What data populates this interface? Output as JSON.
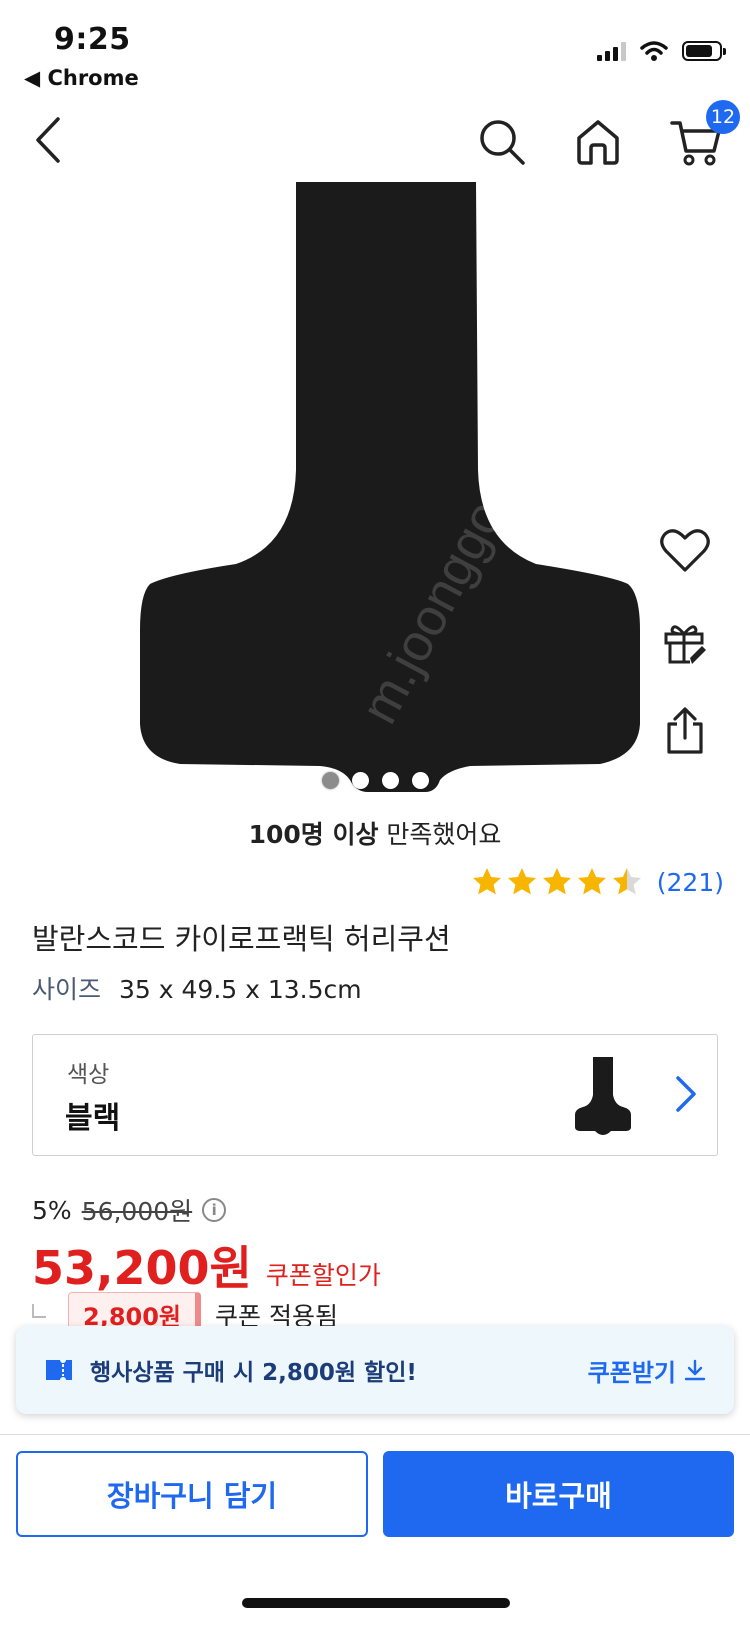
{
  "status_bar": {
    "time": "9:25",
    "back_app": "◀ Chrome"
  },
  "nav": {
    "cart_count": "12"
  },
  "product": {
    "watermark": "m.joonggonara.co.kr",
    "image_dots": 4,
    "satisfaction_bold": "100명 이상",
    "satisfaction_rest": " 만족했어요",
    "rating": 4.5,
    "review_count": "(221)",
    "title": "발란스코드 카이로프랙틱 허리쿠션",
    "size_label": "사이즈",
    "size_value": "35 x 49.5 x 13.5cm"
  },
  "color_option": {
    "label": "색상",
    "value": "블랙"
  },
  "price": {
    "discount_rate": "5%",
    "original": "56,000원",
    "sale": "53,200원",
    "sale_tag": "쿠폰할인가",
    "coupon_amount": "2,800원",
    "coupon_text": "쿠폰 적용됨"
  },
  "banner": {
    "text": "행사상품 구매 시 2,800원 할인!",
    "button": "쿠폰받기"
  },
  "actions": {
    "cart": "장바구니 담기",
    "buy": "바로구매"
  },
  "colors": {
    "accent": "#1e69f0",
    "sale_red": "#e0201e",
    "star": "#f7b500"
  }
}
